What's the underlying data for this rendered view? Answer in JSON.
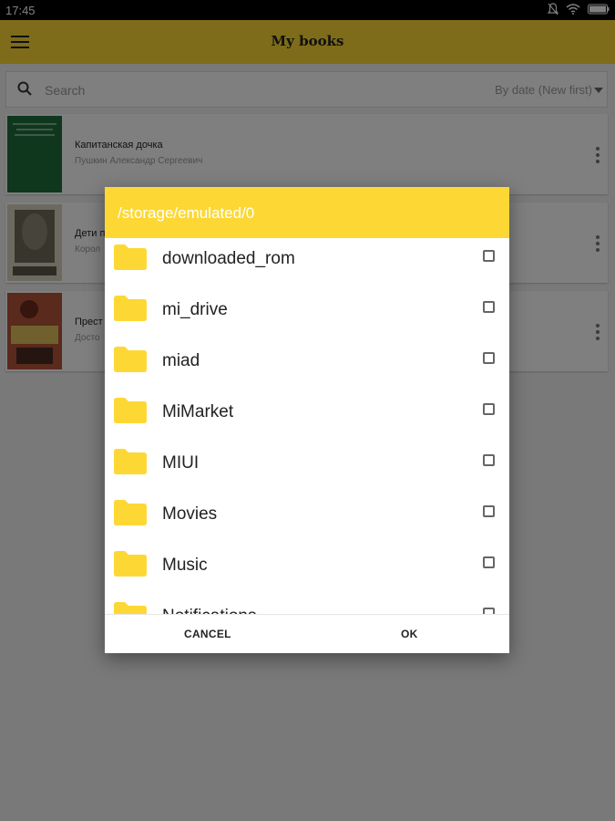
{
  "status_bar": {
    "time": "17:45",
    "icons": [
      "mute-icon",
      "wifi-icon",
      "battery-icon"
    ]
  },
  "app_bar": {
    "title": "My books"
  },
  "search": {
    "placeholder": "Search",
    "sort": "By date (New first)"
  },
  "books": [
    {
      "title": "Капитанская дочка",
      "author": "Пушкин Александр Сергеевич",
      "cover_color": "#1e6b3a"
    },
    {
      "title": "Дети п",
      "author": "Корол",
      "cover_color": "#6b6b5c"
    },
    {
      "title": "Прест",
      "author": "Досто",
      "cover_color": "#7a2b1f"
    }
  ],
  "dialog": {
    "path": "/storage/emulated/0",
    "folders": [
      "downloaded_rom",
      "mi_drive",
      "miad",
      "MiMarket",
      "MIUI",
      "Movies",
      "Music",
      "Notifications"
    ],
    "cancel_label": "CANCEL",
    "ok_label": "OK"
  },
  "colors": {
    "accent": "#fdd835",
    "folder": "#fdd835"
  }
}
